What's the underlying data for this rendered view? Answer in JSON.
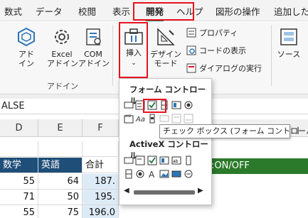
{
  "tabs": [
    {
      "label": "数式"
    },
    {
      "label": "データ"
    },
    {
      "label": "校閲"
    },
    {
      "label": "表示"
    },
    {
      "label": "開発"
    },
    {
      "label": "ヘルプ"
    },
    {
      "label": "図形の操作"
    },
    {
      "label": "追加した"
    }
  ],
  "ribbon": {
    "addins_group": {
      "label": "アドイン",
      "buttons": [
        {
          "label": "アド\nイン"
        },
        {
          "label": "Excel\nアドイン"
        },
        {
          "label": "COM\nアドイン"
        }
      ]
    },
    "controls_group": {
      "insert_label": "挿入",
      "design_mode_label": "デザイン\nモード",
      "properties_label": "プロパティ",
      "view_code_label": "コードの表示",
      "run_dialog_label": "ダイアログの実行"
    },
    "xml_group": {
      "source_label": "ソース"
    }
  },
  "formula_bar": {
    "text": "ALSE"
  },
  "columns": [
    {
      "label": "D"
    },
    {
      "label": "E"
    },
    {
      "label": "F"
    }
  ],
  "grid": {
    "header_row": [
      "数学",
      "英語",
      "合計"
    ],
    "rows": [
      [
        "55",
        "64",
        "187."
      ],
      [
        "71",
        "50",
        "195."
      ],
      [
        "55",
        "75",
        "196.0"
      ]
    ],
    "green_cell": ":ON/OFF"
  },
  "insert_panel": {
    "form_controls_title": "フォーム コントロール",
    "activex_controls_title": "ActiveX コントロール"
  },
  "tooltip": {
    "text": "チェック ボックス (フォーム コントロール)"
  },
  "colors": {
    "accent": "#1f7244",
    "highlight": "#e8121f",
    "table_header": "#1f4e78",
    "sum_fill": "#ddebf7",
    "green_fill": "#2b7a2b"
  }
}
